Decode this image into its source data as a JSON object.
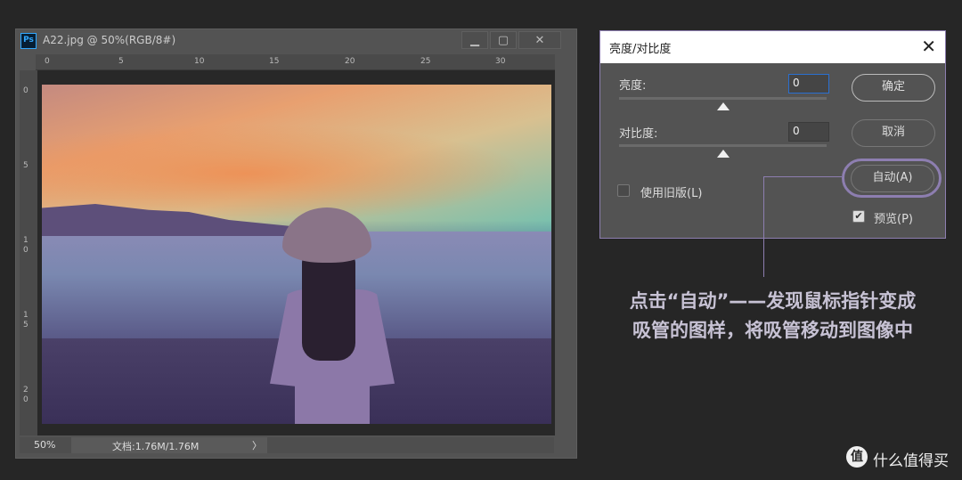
{
  "ps_window": {
    "logo": "Ps",
    "title": "A22.jpg @ 50%(RGB/8#)",
    "minimize_icon": "minimize-icon",
    "maximize_icon": "maximize-icon",
    "close_icon": "close-icon",
    "ruler_top": [
      "0",
      "5",
      "10",
      "15",
      "20",
      "25",
      "30"
    ],
    "ruler_left": [
      "0",
      "5",
      "1\n0",
      "1\n5",
      "2\n0"
    ],
    "status": {
      "zoom": "50%",
      "doc": "文档:1.76M/1.76M",
      "arrow": "〉"
    }
  },
  "dialog": {
    "title": "亮度/对比度",
    "close": "✕",
    "brightness": {
      "label": "亮度:",
      "value": "0"
    },
    "contrast": {
      "label": "对比度:",
      "value": "0"
    },
    "legacy": {
      "label": "使用旧版(L)",
      "checked": false
    },
    "ok": "确定",
    "cancel": "取消",
    "auto": "自动(A)",
    "preview": {
      "label": "预览(P)",
      "checked": true
    }
  },
  "annotation": {
    "line1": "点击“自动”——发现鼠标指针变成",
    "line2": "吸管的图样，将吸管移动到图像中",
    "highlight_color": "#8d7eb0"
  },
  "watermark": {
    "logo": "值",
    "text": "什么值得买"
  }
}
